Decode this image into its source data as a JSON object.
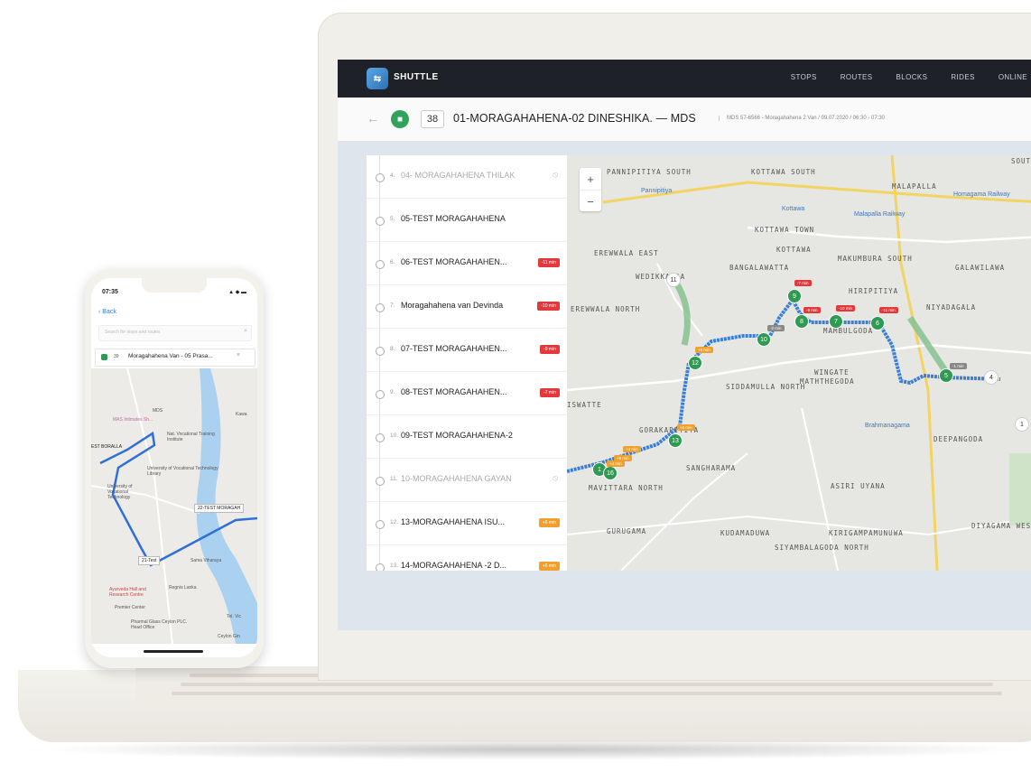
{
  "topbar": {
    "logo_text": "SHUTTLE",
    "nav": [
      "STOPS",
      "ROUTES",
      "BLOCKS",
      "RIDES",
      "ONLINE"
    ]
  },
  "header": {
    "route_number": "38",
    "route_title": "01-MORAGAHAHENA-02 DINESHIKA. — MDS",
    "route_meta": "MDS 57-6566 - Moragahahena 2 Van / 09.07.2020 / 06:30 - 07:30"
  },
  "stops": [
    {
      "idx": "4.",
      "name": "04- MORAGAHAHENA THILAK",
      "dim": true,
      "eye": true
    },
    {
      "idx": "5.",
      "name": "05-TEST MORAGAHAHENA"
    },
    {
      "idx": "6.",
      "name": "06-TEST MORAGAHAHEN...",
      "badge": "-11 min",
      "badge_color": "red"
    },
    {
      "idx": "7.",
      "name": "Moragahahena van Devinda",
      "badge": "-10 min",
      "badge_color": "red"
    },
    {
      "idx": "8.",
      "name": "07-TEST MORAGAHAHEN...",
      "badge": "-9 min",
      "badge_color": "red"
    },
    {
      "idx": "9.",
      "name": "08-TEST MORAGAHAHEN...",
      "badge": "-7 min",
      "badge_color": "red"
    },
    {
      "idx": "10.",
      "name": "09-TEST MORAGAHAHENA-2"
    },
    {
      "idx": "11.",
      "name": "10-MORAGAHAHENA GAYAN",
      "dim": true,
      "eye": true
    },
    {
      "idx": "12.",
      "name": "13-MORAGAHAHENA ISU...",
      "badge": "+6 min",
      "badge_color": "orange"
    },
    {
      "idx": "13.",
      "name": "14-MORAGAHAHENA -2 D...",
      "badge": "+6 min",
      "badge_color": "orange"
    }
  ],
  "map": {
    "zoom_in": "+",
    "zoom_out": "−",
    "labels": [
      "PANNIPITIYA SOUTH",
      "KOTTAWA SOUTH",
      "SOUTH",
      "Pannipitiya",
      "MALAPALLA",
      "Kottawa",
      "Malapalla Railway",
      "Homagama Railway",
      "KOTTAWA TOWN",
      "KOTTAWA",
      "EREWWALA EAST",
      "BANGALAWATTA",
      "MAKUMBURA SOUTH",
      "GALAWILAWA",
      "WEDIKKANDA",
      "HIRIPITIYA",
      "NIYADAGALA",
      "EREWWALA NORTH",
      "MAMBULGODA",
      "WINGATE",
      "SIDDAMULLA NORTH",
      "MATHTHEGODA",
      "ISWATTE",
      "GORAKAPITIYA",
      "Brahmanagama",
      "DEEPANGODA",
      "SANGHARAMA",
      "MAVITTARA NORTH",
      "ASIRI UYANA",
      "GURUGAMA",
      "KUDAMADUWA",
      "KIRIGAMPAMUNUWA",
      "DIYAGAMA WEST",
      "SIYAMBALAGODA NORTH"
    ],
    "pins": [
      "11",
      "9",
      "8",
      "7",
      "6",
      "10",
      "5",
      "4",
      "12",
      "13",
      "1",
      "16",
      "1"
    ],
    "tags": [
      "-7 min",
      "-9 min",
      "-10 min",
      "-11 min",
      "-2 min",
      "+5 min",
      "+6 min",
      "+4 min",
      "+6 min",
      "+4 min",
      "-1 min"
    ]
  },
  "phone": {
    "time": "07:35",
    "status": "▲ ◆ ▬",
    "back": "Back",
    "search_placeholder": "Search for stops and routes",
    "route_num": "39",
    "route_text": "Moragahahena Van - 05 Prasa...",
    "labels": {
      "mds": "MDS",
      "mas": "MAS Intimates Sh...",
      "voc": "Nat. Vocational Training Institute",
      "borella": "EST BORALLA",
      "uni_lib": "University of Vocational Technology Library",
      "uni": "University of Vocational Technology",
      "test22": "22-TEST MORAGAH",
      "test21": "21-Test",
      "sama": "Sama Viharaya",
      "regnis": "Regnis Lanka",
      "ayurveda": "Ayurveda Hall and Research Centre",
      "premier": "Premier Center",
      "pharma": "Pharmal Glass Ceylon PLC. Head Office",
      "tel": "Tel. Vic",
      "ceylon": "Ceylon Gin",
      "kawa": "Kawa"
    }
  }
}
